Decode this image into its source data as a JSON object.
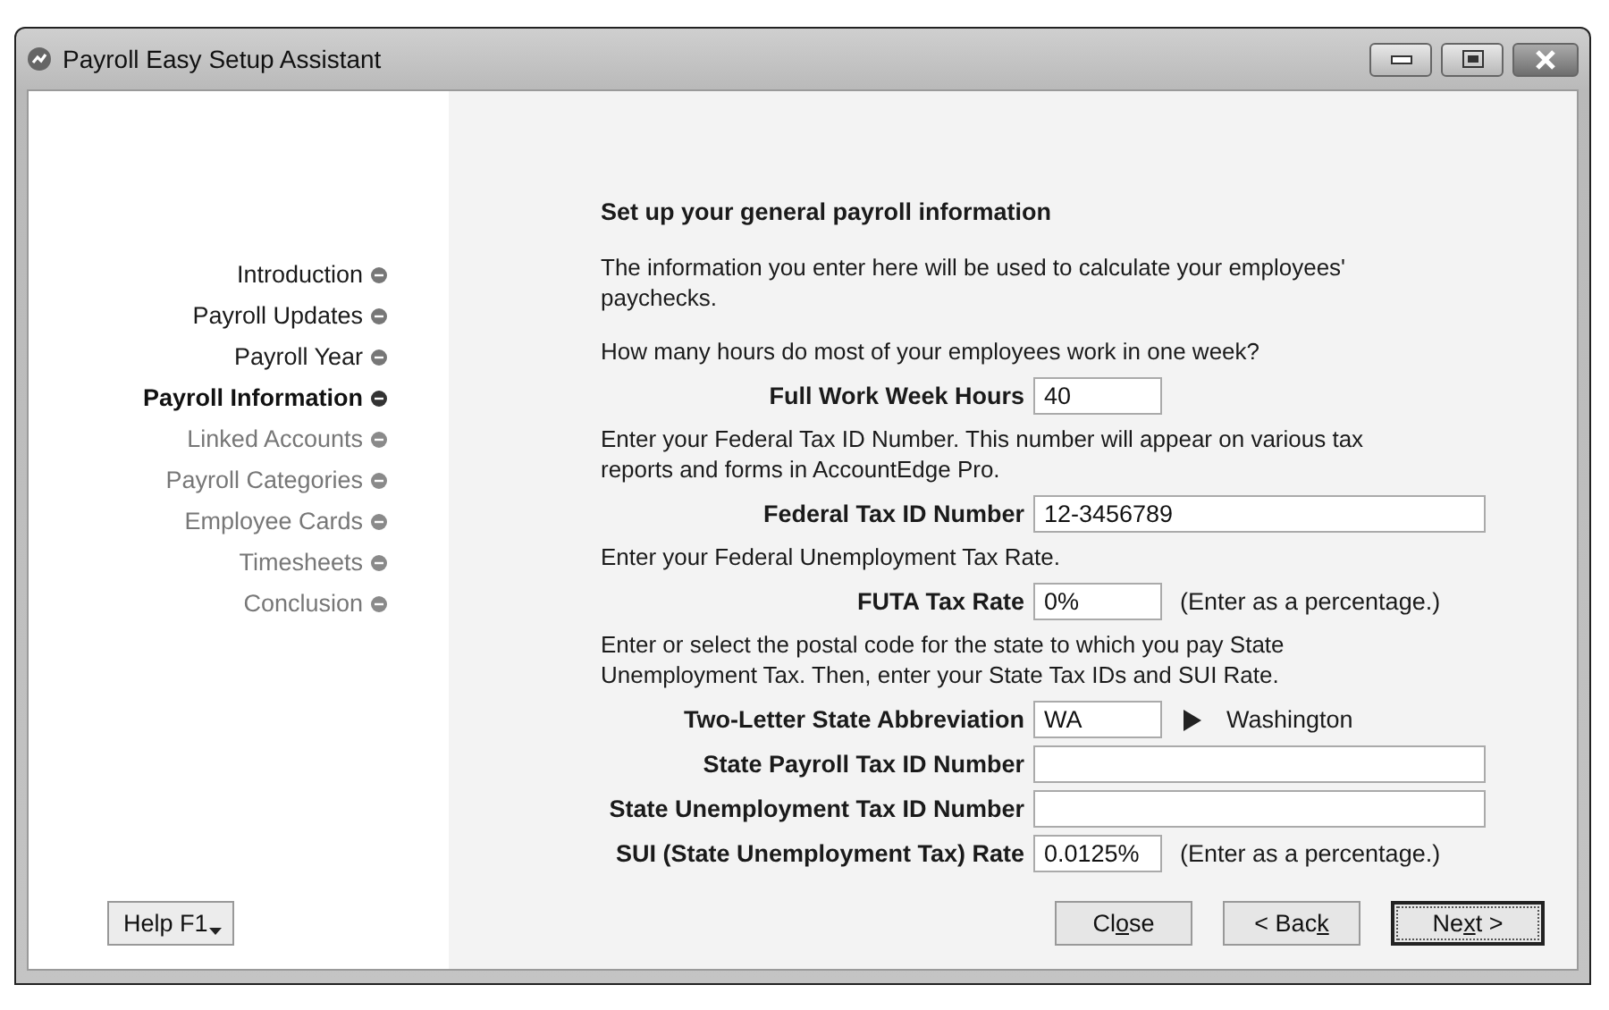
{
  "window": {
    "title": "Payroll Easy Setup Assistant"
  },
  "steps": [
    {
      "label": "Introduction",
      "selected": false,
      "disabled": false
    },
    {
      "label": "Payroll Updates",
      "selected": false,
      "disabled": false
    },
    {
      "label": "Payroll Year",
      "selected": false,
      "disabled": false
    },
    {
      "label": "Payroll Information",
      "selected": true,
      "disabled": false
    },
    {
      "label": "Linked Accounts",
      "selected": false,
      "disabled": true
    },
    {
      "label": "Payroll Categories",
      "selected": false,
      "disabled": true
    },
    {
      "label": "Employee Cards",
      "selected": false,
      "disabled": true
    },
    {
      "label": "Timesheets",
      "selected": false,
      "disabled": true
    },
    {
      "label": "Conclusion",
      "selected": false,
      "disabled": true
    }
  ],
  "heading": "Set up your general payroll information",
  "form": [
    {
      "kind": "paragraph",
      "text": "The information you enter here will be used to calculate your employees' paychecks."
    },
    {
      "kind": "paragraph",
      "text": "How many hours do most of your employees work in one week?"
    },
    {
      "kind": "short-field",
      "label": "Full Work Week Hours",
      "value": "40"
    },
    {
      "kind": "paragraph",
      "text": "Enter your Federal Tax ID Number.  This number will appear on various tax reports and forms in AccountEdge Pro."
    },
    {
      "kind": "long-field",
      "label": "Federal Tax ID Number",
      "value": "12-3456789"
    },
    {
      "kind": "paragraph",
      "text": "Enter your Federal Unemployment Tax Rate."
    },
    {
      "kind": "short-field",
      "label": "FUTA Tax Rate",
      "value": "0%",
      "note": "(Enter as a percentage.)"
    },
    {
      "kind": "paragraph",
      "text": "Enter or select the postal code for the state to which you pay State Unemployment Tax.  Then, enter your State Tax IDs and SUI Rate."
    },
    {
      "kind": "short-field",
      "label": "Two-Letter State Abbreviation",
      "value": "WA",
      "lookup": "Washington"
    },
    {
      "kind": "long-field",
      "label": "State Payroll Tax ID Number"
    },
    {
      "kind": "long-field",
      "label": "State Unemployment Tax ID Number"
    },
    {
      "kind": "short-field",
      "label": "SUI (State Unemployment Tax) Rate",
      "value": "0.0125%",
      "note": "(Enter as a percentage.)"
    }
  ],
  "help_button": {
    "label": "Help F1"
  },
  "buttons": [
    {
      "before": "Cl",
      "key": "o",
      "after": "se",
      "default": false
    },
    {
      "before": "< Bac",
      "key": "k",
      "default": false
    },
    {
      "before": "Ne",
      "key": "x",
      "after": "t >",
      "default": true
    }
  ]
}
